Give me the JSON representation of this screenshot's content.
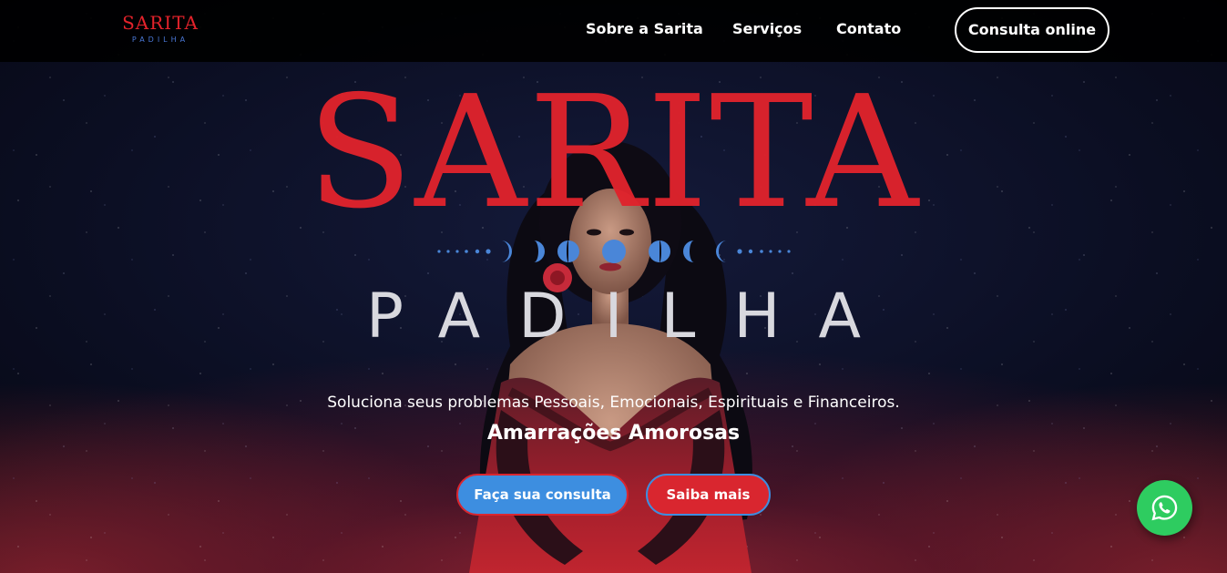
{
  "colors": {
    "brand_red": "#e0232c",
    "brand_blue": "#3d8ee0",
    "whatsapp_green": "#2ecc60",
    "nav_bg": "#000000"
  },
  "header": {
    "logo": {
      "top": "SARITA",
      "bottom": "PADILHA"
    },
    "nav": [
      {
        "label": "Sobre a Sarita"
      },
      {
        "label": "Serviços"
      },
      {
        "label": "Contato"
      }
    ],
    "cta_label": "Consulta online"
  },
  "hero": {
    "title": "SARITA",
    "subtitle": "PADILHA",
    "tagline": "Soluciona seus problemas Pessoais, Emocionais, Espirituais e Financeiros.",
    "subtagline": "Amarrações Amorosas",
    "primary_button": "Faça sua consulta",
    "secondary_button": "Saiba mais",
    "moon_phases_icon": "moon-phases-ornament",
    "figure_icon": "woman-portrait"
  },
  "floating": {
    "whatsapp_icon": "whatsapp-icon"
  }
}
